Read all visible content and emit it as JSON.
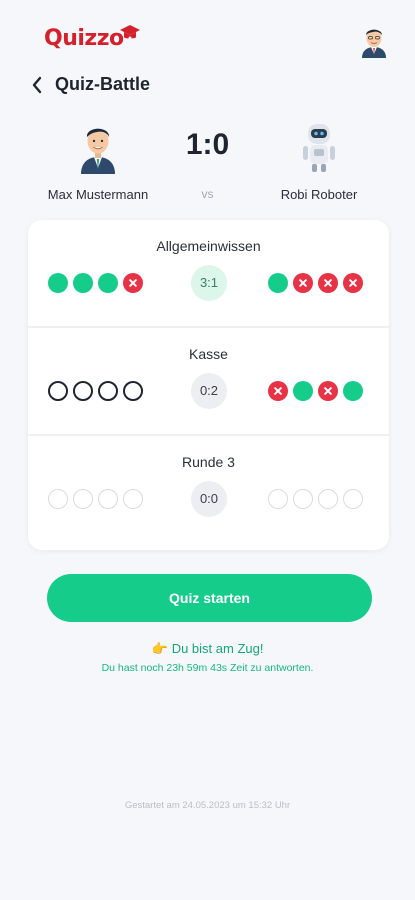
{
  "app": {
    "logo_text": "Quizzo",
    "brand_color": "#d5202d",
    "accent_color": "#15cc8a",
    "wrong_color": "#e63346"
  },
  "nav": {
    "title": "Quiz-Battle",
    "back_icon": "chevron-left-icon"
  },
  "battle": {
    "player1": {
      "name": "Max Mustermann",
      "avatar": "businessman-avatar-icon"
    },
    "player2": {
      "name": "Robi Roboter",
      "avatar": "robot-avatar-icon"
    },
    "score": "1:0",
    "vs": "vs"
  },
  "rounds": [
    {
      "name": "Allgemeinwissen",
      "score": "3:1",
      "state": "won",
      "player1_answers": [
        "correct",
        "correct",
        "correct",
        "wrong"
      ],
      "player2_answers": [
        "correct",
        "wrong",
        "wrong",
        "wrong"
      ]
    },
    {
      "name": "Kasse",
      "score": "0:2",
      "state": "lost",
      "player1_answers": [
        "empty",
        "empty",
        "empty",
        "empty"
      ],
      "player2_answers": [
        "wrong",
        "correct",
        "wrong",
        "correct"
      ]
    },
    {
      "name": "Runde 3",
      "score": "0:0",
      "state": "open",
      "player1_answers": [
        "muted",
        "muted",
        "muted",
        "muted"
      ],
      "player2_answers": [
        "muted",
        "muted",
        "muted",
        "muted"
      ]
    }
  ],
  "action": {
    "start_label": "Quiz starten",
    "turn_icon": "👉",
    "turn_text": "Du bist am Zug!",
    "time_text": "Du hast noch 23h 59m 43s Zeit zu antworten."
  },
  "footer": {
    "started_text": "Gestartet am 24.05.2023 um 15:32 Uhr"
  }
}
